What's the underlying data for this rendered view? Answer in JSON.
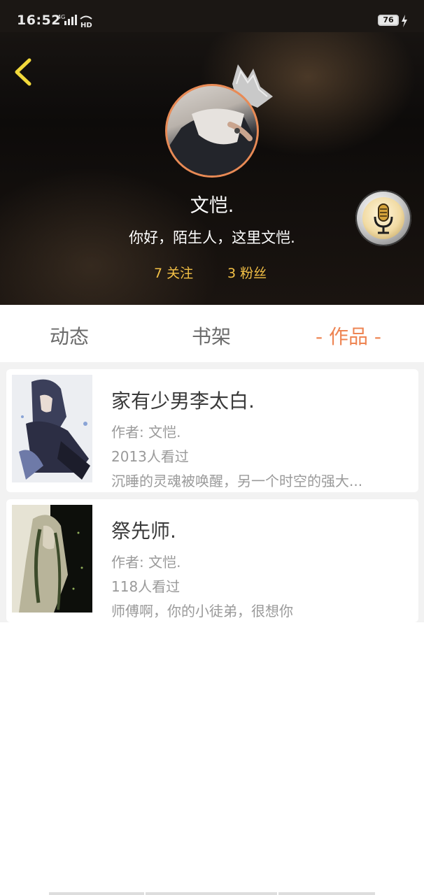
{
  "status_bar": {
    "time": "16:52",
    "network": "4G",
    "hd_label": "HD",
    "battery": "76"
  },
  "profile": {
    "name": "文恺.",
    "bio": "你好，陌生人，这里文恺.",
    "following": "7 关注",
    "followers": "3 粉丝"
  },
  "tabs": [
    {
      "label": "动态",
      "active": false
    },
    {
      "label": "书架",
      "active": false
    },
    {
      "label": "- 作品 -",
      "active": true
    }
  ],
  "works": [
    {
      "title": "家有少男李太白.",
      "author": "作者: 文恺.",
      "views": "2013人看过",
      "description": "沉睡的灵魂被唤醒，另一个时空的强大..."
    },
    {
      "title": "祭先师.",
      "author": "作者: 文恺.",
      "views": "118人看过",
      "description": "师傅啊，你的小徒弟，很想你"
    }
  ],
  "colors": {
    "accent_orange": "#ee8452",
    "stats_gold": "#f3c046",
    "back_arrow_yellow": "#f2d93b"
  },
  "icons": [
    "back-arrow-icon",
    "crown-icon",
    "microphone-icon",
    "signal-icon",
    "battery-icon",
    "charging-icon"
  ]
}
